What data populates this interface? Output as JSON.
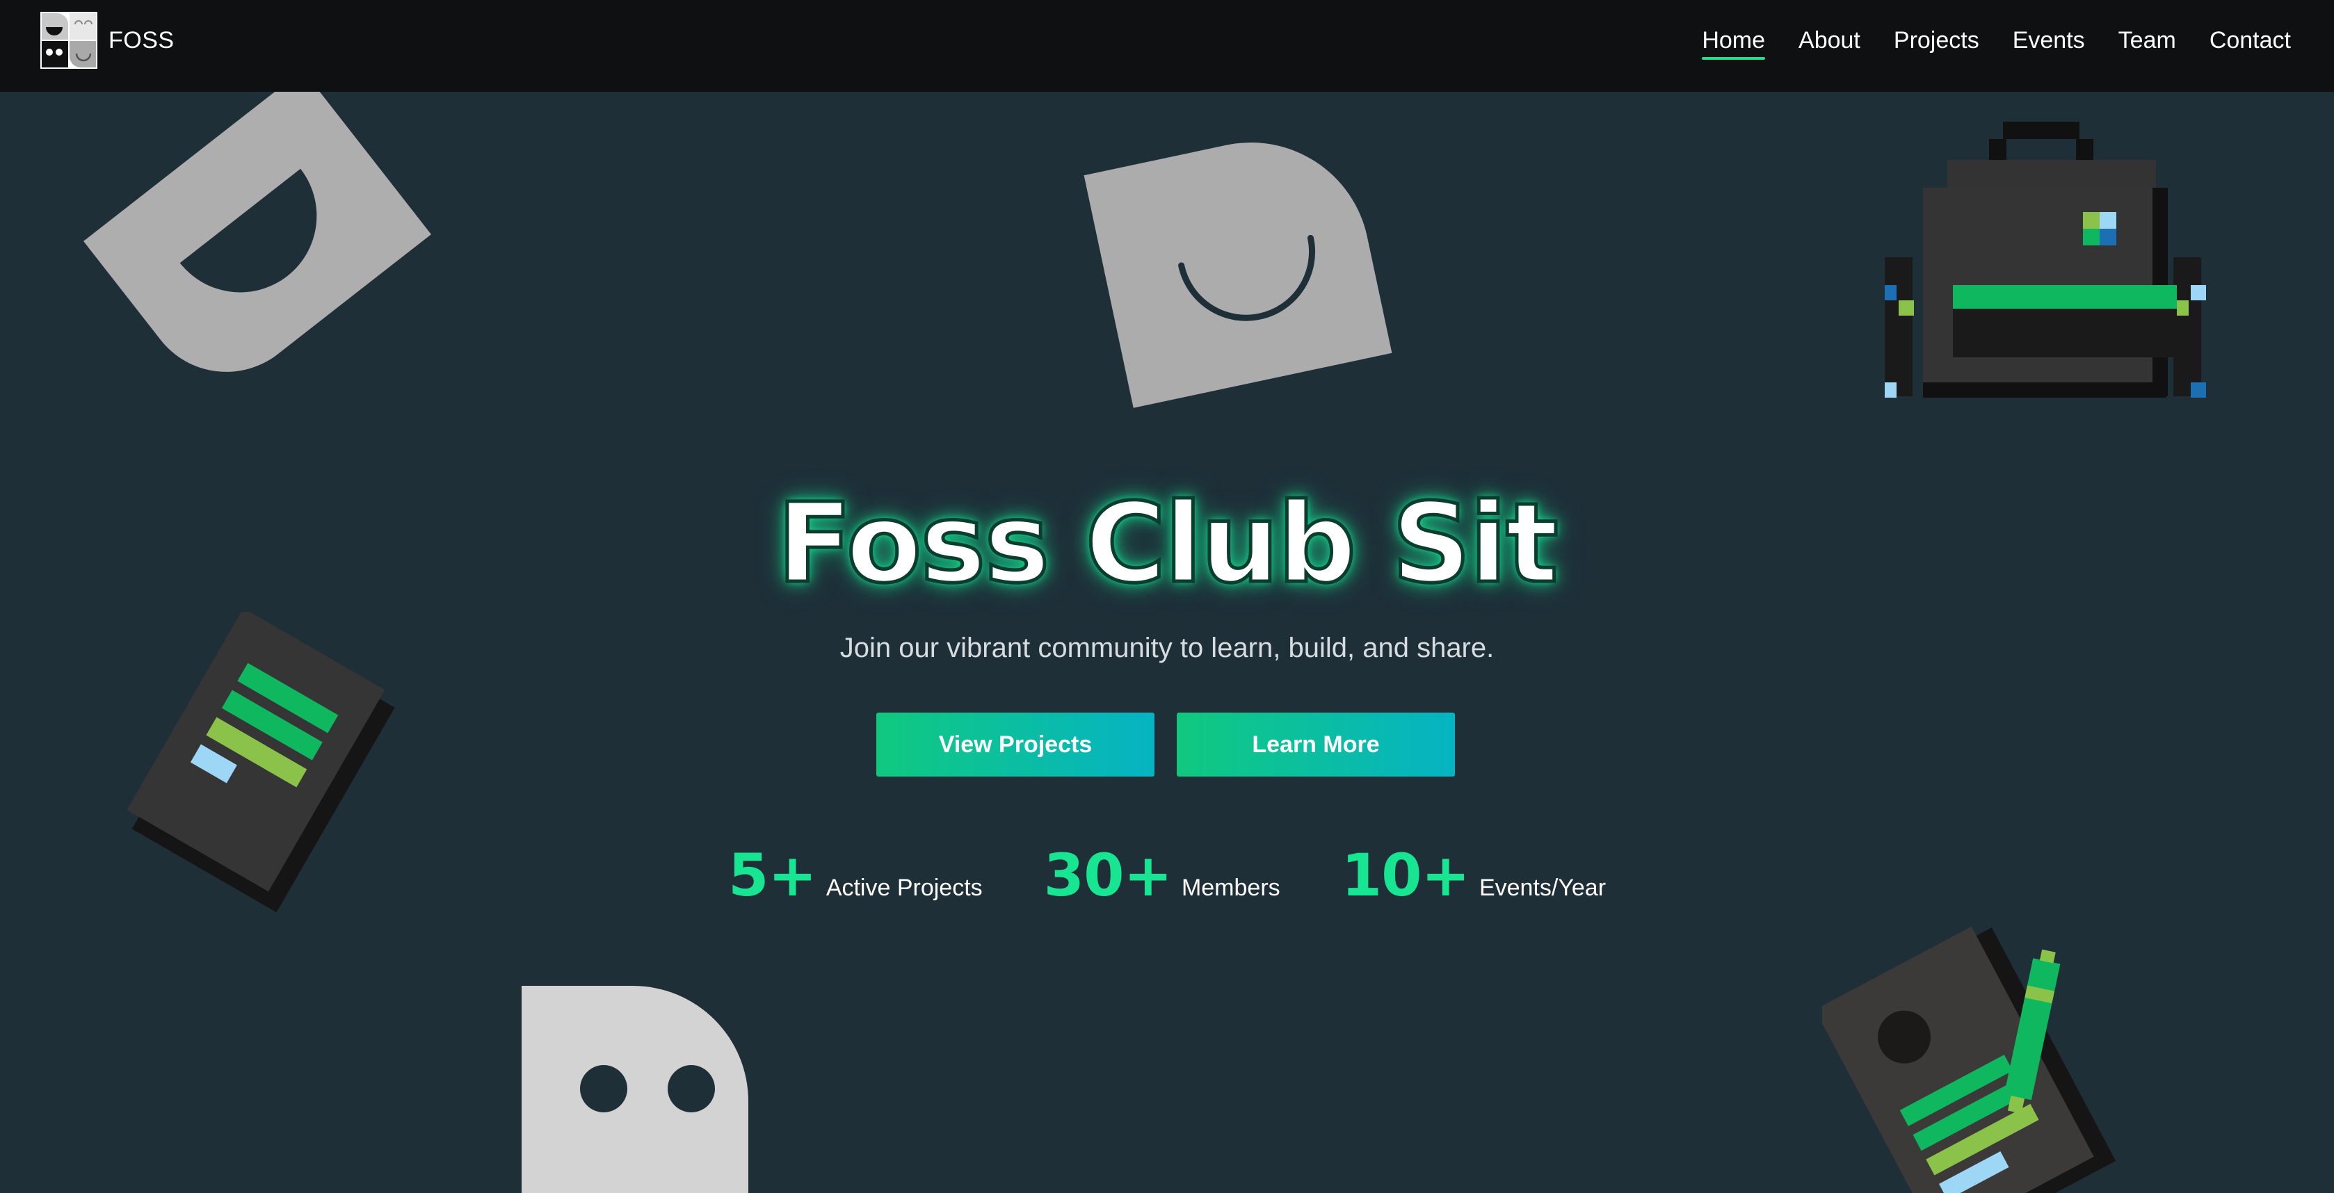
{
  "nav": {
    "brand": "FOSS",
    "links": [
      {
        "label": "Home",
        "active": true
      },
      {
        "label": "About",
        "active": false
      },
      {
        "label": "Projects",
        "active": false
      },
      {
        "label": "Events",
        "active": false
      },
      {
        "label": "Team",
        "active": false
      },
      {
        "label": "Contact",
        "active": false
      }
    ]
  },
  "hero": {
    "title": "Foss Club Sit",
    "subtitle": "Join our vibrant community to learn, build, and share.",
    "buttons": {
      "primary": "View Projects",
      "secondary": "Learn More"
    }
  },
  "stats": [
    {
      "value": "5+",
      "label": "Active Projects"
    },
    {
      "value": "30+",
      "label": "Members"
    },
    {
      "value": "10+",
      "label": "Events/Year"
    }
  ],
  "decorations": [
    "grin-face-icon",
    "smile-face-icon",
    "pixel-backpack-icon",
    "pixel-notepad-icon",
    "pixel-notebook-pen-icon",
    "eyes-face-icon"
  ],
  "colors": {
    "accent": "#17e592",
    "background": "#1e2f38",
    "navbar": "#0f1011",
    "button_start": "#10c97f",
    "button_end": "#06b3c4"
  }
}
